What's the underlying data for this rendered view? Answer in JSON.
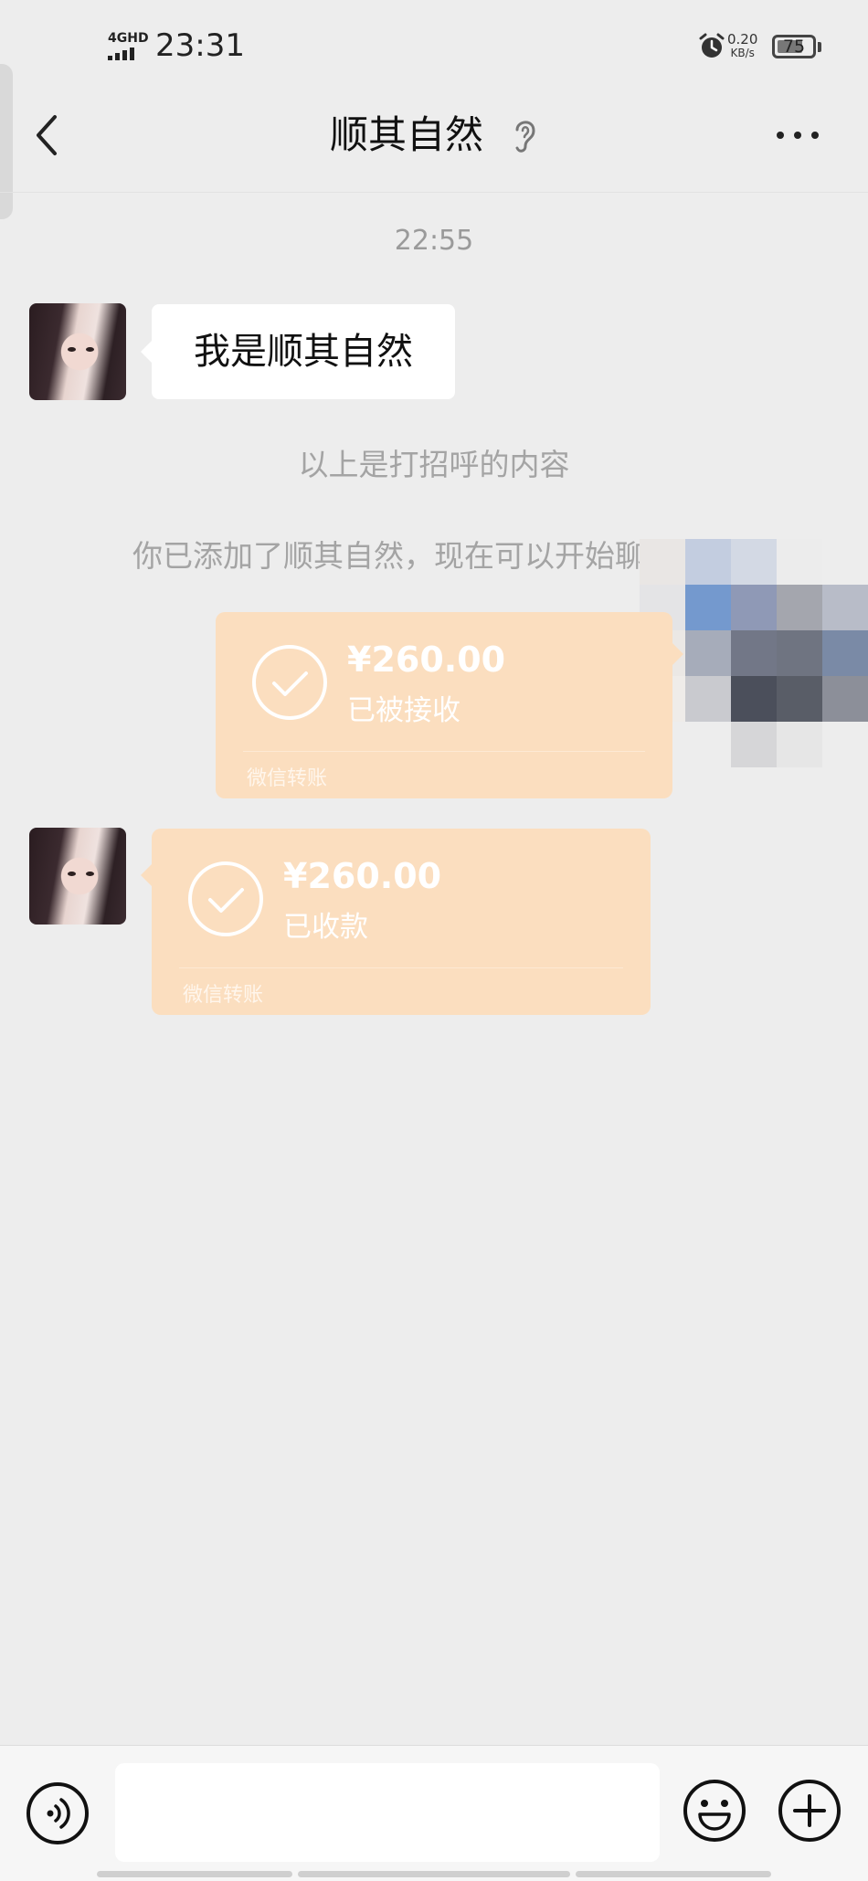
{
  "status_bar": {
    "network": "4GHD",
    "time": "23:31",
    "speed_value": "0.20",
    "speed_unit": "KB/s",
    "battery": "75",
    "battery_level": 0.75,
    "icons": [
      "signal-icon",
      "alarm-icon",
      "battery-icon"
    ]
  },
  "header": {
    "title": "顺其自然",
    "icons": [
      "back-icon",
      "ear-icon",
      "more-icon"
    ]
  },
  "chat": {
    "timestamp": "22:55",
    "greeting_message": "我是顺其自然",
    "system_notes": [
      "以上是打招呼的内容",
      "你已添加了顺其自然，现在可以开始聊天了。"
    ],
    "transfers": [
      {
        "amount": "¥260.00",
        "status": "已被接收",
        "footer": "微信转账",
        "side": "right"
      },
      {
        "amount": "¥260.00",
        "status": "已收款",
        "footer": "微信转账",
        "side": "left"
      }
    ]
  },
  "input_bar": {
    "text_value": "",
    "icons": [
      "voice-icon",
      "emoji-icon",
      "plus-icon"
    ]
  },
  "colors": {
    "background": "#ededed",
    "transfer_orange": "#fbdebf",
    "system_text": "#a4a4a4"
  }
}
